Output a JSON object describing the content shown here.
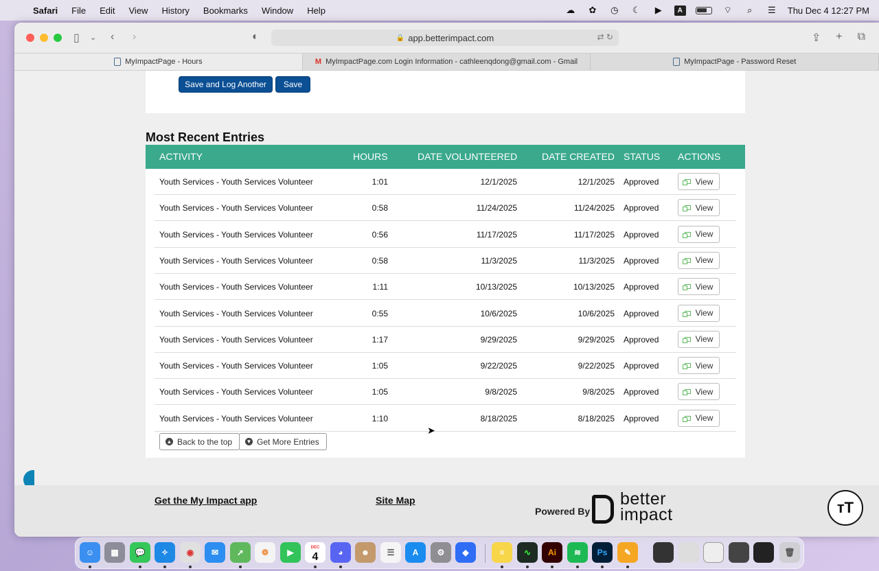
{
  "menubar": {
    "app": "Safari",
    "items": [
      "File",
      "Edit",
      "View",
      "History",
      "Bookmarks",
      "Window",
      "Help"
    ],
    "clock": "Thu Dec 4  12:27 PM",
    "input_source": "A"
  },
  "browser": {
    "url": "app.betterimpact.com",
    "tabs": [
      {
        "label": "MyImpactPage - Hours",
        "active": true
      },
      {
        "label": "MyImpactPage.com Login Information - cathleenqdong@gmail.com - Gmail",
        "active": false
      },
      {
        "label": "MyImpactPage - Password Reset",
        "active": false
      }
    ]
  },
  "form_actions": {
    "save_and_log_another": "Save and Log Another",
    "save": "Save"
  },
  "entries": {
    "title": "Most Recent Entries",
    "columns": {
      "activity": "ACTIVITY",
      "hours": "HOURS",
      "date_volunteered": "DATE VOLUNTEERED",
      "date_created": "DATE CREATED",
      "status": "STATUS",
      "actions": "ACTIONS"
    },
    "view_label": "View",
    "rows": [
      {
        "activity": "Youth Services - Youth Services Volunteer",
        "hours": "1:01",
        "date_volunteered": "12/1/2025",
        "date_created": "12/1/2025",
        "status": "Approved"
      },
      {
        "activity": "Youth Services - Youth Services Volunteer",
        "hours": "0:58",
        "date_volunteered": "11/24/2025",
        "date_created": "11/24/2025",
        "status": "Approved"
      },
      {
        "activity": "Youth Services - Youth Services Volunteer",
        "hours": "0:56",
        "date_volunteered": "11/17/2025",
        "date_created": "11/17/2025",
        "status": "Approved"
      },
      {
        "activity": "Youth Services - Youth Services Volunteer",
        "hours": "0:58",
        "date_volunteered": "11/3/2025",
        "date_created": "11/3/2025",
        "status": "Approved"
      },
      {
        "activity": "Youth Services - Youth Services Volunteer",
        "hours": "1:11",
        "date_volunteered": "10/13/2025",
        "date_created": "10/13/2025",
        "status": "Approved"
      },
      {
        "activity": "Youth Services - Youth Services Volunteer",
        "hours": "0:55",
        "date_volunteered": "10/6/2025",
        "date_created": "10/6/2025",
        "status": "Approved"
      },
      {
        "activity": "Youth Services - Youth Services Volunteer",
        "hours": "1:17",
        "date_volunteered": "9/29/2025",
        "date_created": "9/29/2025",
        "status": "Approved"
      },
      {
        "activity": "Youth Services - Youth Services Volunteer",
        "hours": "1:05",
        "date_volunteered": "9/22/2025",
        "date_created": "9/22/2025",
        "status": "Approved"
      },
      {
        "activity": "Youth Services - Youth Services Volunteer",
        "hours": "1:05",
        "date_volunteered": "9/8/2025",
        "date_created": "9/8/2025",
        "status": "Approved"
      },
      {
        "activity": "Youth Services - Youth Services Volunteer",
        "hours": "1:10",
        "date_volunteered": "8/18/2025",
        "date_created": "8/18/2025",
        "status": "Approved"
      }
    ],
    "back_to_top": "Back to the top",
    "get_more": "Get More Entries"
  },
  "footer": {
    "app_link": "Get the My Impact app",
    "site_map": "Site Map",
    "powered_by": "Powered By",
    "brand_word": "better impact",
    "text_size_badge": "тT"
  },
  "colors": {
    "primary_button": "#0b4f94",
    "table_header": "#3aa98c",
    "view_icon": "#5cb85c"
  },
  "dock": {
    "calendar_month": "DEC",
    "calendar_day": "4",
    "apps": [
      "finder",
      "launchpad",
      "messages",
      "safari",
      "chrome",
      "mail",
      "maps",
      "photos",
      "facetime",
      "calendar",
      "discord",
      "contacts",
      "reminders",
      "app-store",
      "system-settings",
      "roblox",
      "notes",
      "activity-monitor",
      "illustrator",
      "spotify",
      "photoshop",
      "pages",
      "window-1",
      "window-2",
      "window-3",
      "window-4",
      "window-5",
      "trash"
    ]
  }
}
